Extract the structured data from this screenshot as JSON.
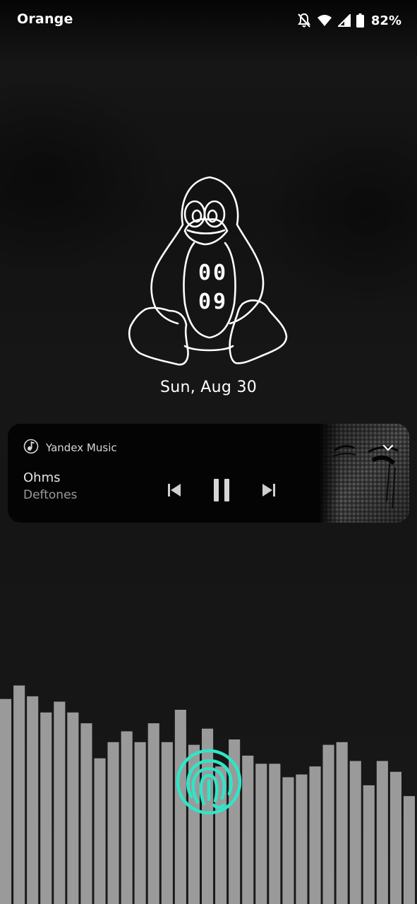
{
  "status_bar": {
    "carrier": "Orange",
    "battery_percent": "82%",
    "icons": [
      "notifications-off-icon",
      "wifi-icon",
      "cellular-signal-icon",
      "battery-icon"
    ]
  },
  "lock_screen": {
    "clock_hours": "00",
    "clock_minutes": "09",
    "date": "Sun, Aug 30",
    "clock_style": "tux-penguin-outline"
  },
  "media": {
    "app_name": "Yandex Music",
    "track_title": "Ohms",
    "artist": "Deftones",
    "state": "playing",
    "controls": [
      "previous-icon",
      "pause-icon",
      "next-icon"
    ]
  },
  "visualizer": {
    "bar_color": "#9a9a9a",
    "bar_levels": [
      0.76,
      0.81,
      0.77,
      0.71,
      0.75,
      0.71,
      0.67,
      0.54,
      0.6,
      0.64,
      0.6,
      0.67,
      0.6,
      0.72,
      0.59,
      0.65,
      0.51,
      0.61,
      0.55,
      0.52,
      0.52,
      0.47,
      0.48,
      0.51,
      0.59,
      0.6,
      0.53,
      0.44,
      0.53,
      0.49,
      0.4
    ]
  },
  "fingerprint": {
    "accent_color": "#2ee6c8"
  }
}
